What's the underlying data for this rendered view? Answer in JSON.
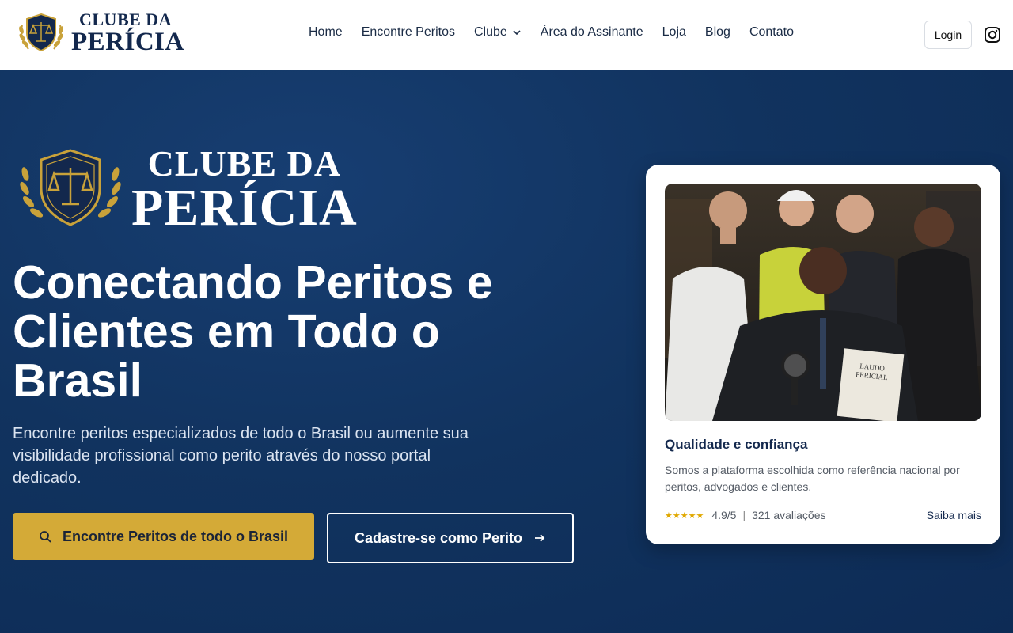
{
  "brand": {
    "line1": "CLUBE DA",
    "line2": "PERÍCIA"
  },
  "nav": {
    "items": [
      {
        "label": "Home"
      },
      {
        "label": "Encontre Peritos"
      },
      {
        "label": "Clube"
      },
      {
        "label": "Área do Assinante"
      },
      {
        "label": "Loja"
      },
      {
        "label": "Blog"
      },
      {
        "label": "Contato"
      }
    ],
    "login": "Login"
  },
  "hero": {
    "logo_line1": "CLUBE DA",
    "logo_line2": "PERÍCIA",
    "title": "Conectando Peritos e Clientes em Todo o Brasil",
    "subtitle": "Encontre peritos especializados de todo o Brasil ou aumente sua visibilidade profissional como perito através do nosso portal dedicado.",
    "primary_button": "Encontre Peritos de todo o Brasil",
    "secondary_button": "Cadastre-se como Perito"
  },
  "card": {
    "photo_doc_line1": "LAUDO",
    "photo_doc_line2": "PERICIAL",
    "title": "Qualidade e confiança",
    "text": "Somos a plataforma escolhida como referência nacional por peritos, advogados e clientes.",
    "stars": "★★★★★",
    "rating": "4.9/5",
    "separator": "|",
    "reviews": "321 avaliações",
    "more": "Saiba mais"
  },
  "colors": {
    "navy": "#13284d",
    "gold": "#d4aa37",
    "hero_bg": "#11335f"
  },
  "icons": [
    "scales-crest-icon",
    "laurel-icon",
    "chevron-down-icon",
    "instagram-icon",
    "search-icon",
    "arrow-right-icon"
  ]
}
